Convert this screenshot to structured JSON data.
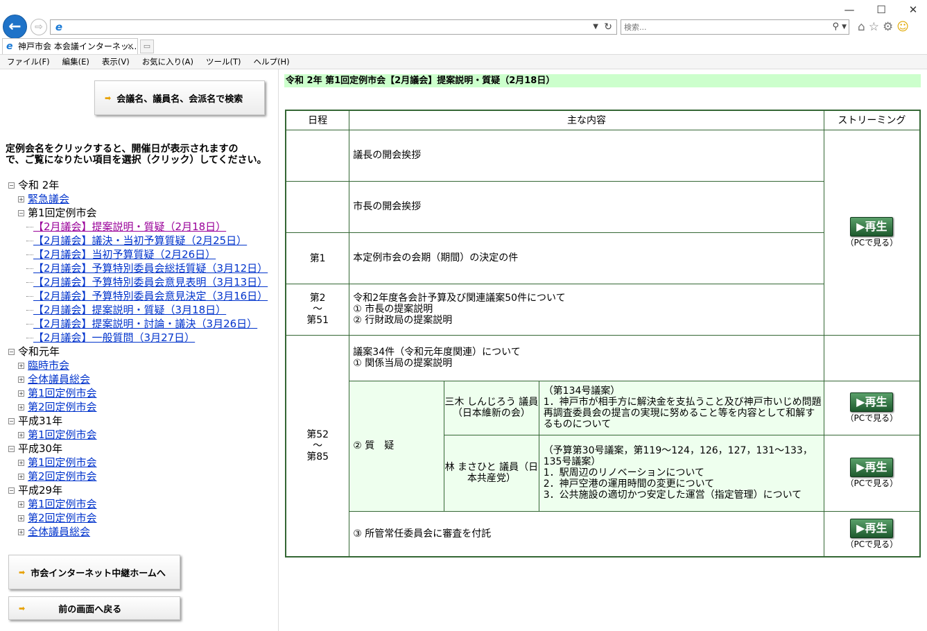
{
  "browser": {
    "tab_title": "神戸市会 本会議インターネッ...",
    "search_placeholder": "検索...",
    "menu": [
      "ファイル(F)",
      "編集(E)",
      "表示(V)",
      "お気に入り(A)",
      "ツール(T)",
      "ヘルプ(H)"
    ]
  },
  "left": {
    "search_button": "会議名、議員名、会派名で検索",
    "instruction_line1": "定例会名をクリックすると、開催日が表示されますの",
    "instruction_line2": "で、ご覧になりたい項目を選択（クリック）してください。",
    "tree": [
      {
        "label": "令和 2年",
        "level": 0,
        "toggle": "−",
        "link": false
      },
      {
        "label": "緊急議会",
        "level": 1,
        "toggle": "+",
        "link": true
      },
      {
        "label": "第1回定例市会",
        "level": 1,
        "toggle": "−",
        "link": false
      },
      {
        "label": "【2月議会】提案説明・質疑（2月18日）",
        "level": 2,
        "link": true,
        "visited": true
      },
      {
        "label": "【2月議会】議決・当初予算質疑（2月25日）",
        "level": 2,
        "link": true
      },
      {
        "label": "【2月議会】当初予算質疑（2月26日）",
        "level": 2,
        "link": true
      },
      {
        "label": "【2月議会】予算特別委員会総括質疑（3月12日）",
        "level": 2,
        "link": true
      },
      {
        "label": "【2月議会】予算特別委員会意見表明（3月13日）",
        "level": 2,
        "link": true
      },
      {
        "label": "【2月議会】予算特別委員会意見決定（3月16日）",
        "level": 2,
        "link": true
      },
      {
        "label": "【2月議会】提案説明・質疑（3月18日）",
        "level": 2,
        "link": true
      },
      {
        "label": "【2月議会】提案説明・討論・議決（3月26日）",
        "level": 2,
        "link": true
      },
      {
        "label": "【2月議会】一般質問（3月27日）",
        "level": 2,
        "link": true
      },
      {
        "label": "令和元年",
        "level": 0,
        "toggle": "−",
        "link": false
      },
      {
        "label": "臨時市会",
        "level": 1,
        "toggle": "+",
        "link": true
      },
      {
        "label": "全体議員総会",
        "level": 1,
        "toggle": "+",
        "link": true
      },
      {
        "label": "第1回定例市会",
        "level": 1,
        "toggle": "+",
        "link": true
      },
      {
        "label": "第2回定例市会",
        "level": 1,
        "toggle": "+",
        "link": true
      },
      {
        "label": "平成31年",
        "level": 0,
        "toggle": "−",
        "link": false
      },
      {
        "label": "第1回定例市会",
        "level": 1,
        "toggle": "+",
        "link": true
      },
      {
        "label": "平成30年",
        "level": 0,
        "toggle": "−",
        "link": false
      },
      {
        "label": "第1回定例市会",
        "level": 1,
        "toggle": "+",
        "link": true
      },
      {
        "label": "第2回定例市会",
        "level": 1,
        "toggle": "+",
        "link": true
      },
      {
        "label": "平成29年",
        "level": 0,
        "toggle": "−",
        "link": false
      },
      {
        "label": "第1回定例市会",
        "level": 1,
        "toggle": "+",
        "link": true
      },
      {
        "label": "第2回定例市会",
        "level": 1,
        "toggle": "+",
        "link": true
      },
      {
        "label": "全体議員総会",
        "level": 1,
        "toggle": "+",
        "link": true
      }
    ],
    "home_button": "市会インターネット中継ホームへ",
    "back_button": "前の画面へ戻る"
  },
  "main": {
    "title": "令和 2年 第1回定例市会【2月議会】提案説明・質疑（2月18日）",
    "headers": {
      "schedule": "日程",
      "content": "主な内容",
      "stream": "ストリーミング"
    },
    "rows": {
      "r1": "議長の開会挨拶",
      "r2": "市長の開会挨拶",
      "r3_sched": "第1",
      "r3": "本定例市会の会期（期間）の決定の件",
      "r4_sched_a": "第2",
      "r4_sched_b": "〜",
      "r4_sched_c": "第51",
      "r4_l1": "令和2年度各会計予算及び関連議案50件について",
      "r4_l2": "① 市長の提案説明",
      "r4_l3": "② 行財政局の提案説明",
      "r5_sched_a": "第52",
      "r5_sched_b": "〜",
      "r5_sched_c": "第85",
      "r5_l1": "議案34件（令和元年度関連）について",
      "r5_l2": "① 関係当局の提案説明",
      "q_label": "② 質　疑",
      "q1_who": "三木 しんじろう 議員（日本維新の会）",
      "q1_detail": "（第134号議案）\n1．神戸市が相手方に解決金を支払うこと及び神戸市いじめ問題再調査委員会の提言の実現に努めること等を内容として和解するものについて",
      "q2_who": "林 まさひと 議員（日本共産党）",
      "q2_detail": "（予算第30号議案，第119〜124，126，127，131〜133，135号議案）\n1．駅周辺のリノベーションについて\n2．神戸空港の運用時間の変更について\n3．公共施設の適切かつ安定した運営（指定管理）について",
      "r6": "③ 所管常任委員会に審査を付託"
    },
    "play_label": "再生",
    "pc_label": "（PCで見る）"
  }
}
